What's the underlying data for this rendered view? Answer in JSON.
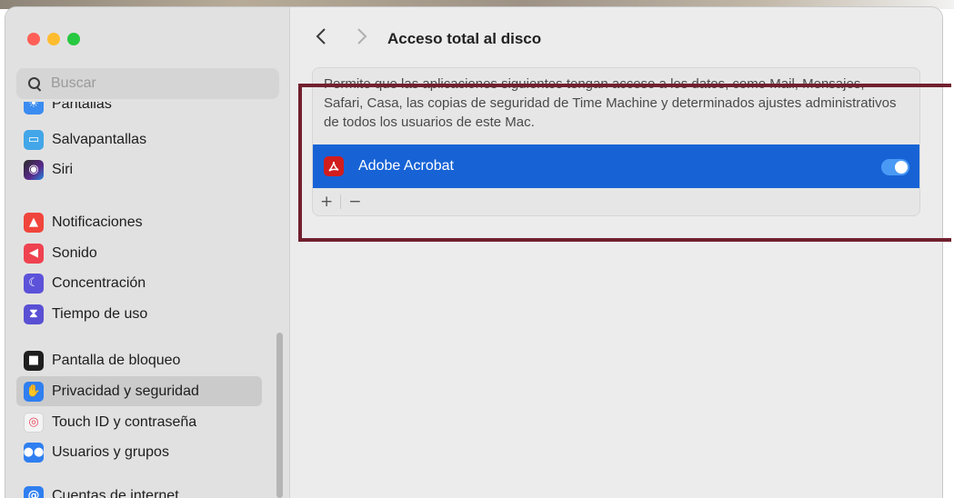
{
  "colors": {
    "accent": "#1763d6",
    "annotation_box": "#72202e"
  },
  "search": {
    "placeholder": "Buscar"
  },
  "sidebar": {
    "items": [
      {
        "label": "Pantallas",
        "icon": "display-icon",
        "color": "#3b8cf0"
      },
      {
        "label": "Salvapantallas",
        "icon": "screensaver-icon",
        "color": "#43a6e8"
      },
      {
        "label": "Siri",
        "icon": "siri-icon",
        "color": "#333333"
      },
      {
        "label": "Notificaciones",
        "icon": "bell-icon",
        "color": "#f0453c"
      },
      {
        "label": "Sonido",
        "icon": "speaker-icon",
        "color": "#ef4250"
      },
      {
        "label": "Concentración",
        "icon": "moon-icon",
        "color": "#5c52d9"
      },
      {
        "label": "Tiempo de uso",
        "icon": "hourglass-icon",
        "color": "#5950d4"
      },
      {
        "label": "Pantalla de bloqueo",
        "icon": "lock-icon",
        "color": "#1f1f1f"
      },
      {
        "label": "Privacidad y seguridad",
        "icon": "hand-icon",
        "color": "#2f7ff0",
        "selected": true
      },
      {
        "label": "Touch ID y contraseña",
        "icon": "fingerprint-icon",
        "color": "#f4f4f4"
      },
      {
        "label": "Usuarios y grupos",
        "icon": "users-icon",
        "color": "#2f7ff0"
      },
      {
        "label": "Cuentas de internet",
        "icon": "at-icon",
        "color": "#2f7ff0"
      }
    ]
  },
  "toolbar": {
    "back_icon": "chevron-left-icon",
    "forward_icon": "chevron-right-icon",
    "title": "Acceso total al disco"
  },
  "panel": {
    "description": "Permite que las aplicaciones siguientes tengan acceso a los datos, como Mail, Mensajes, Safari, Casa, las copias de seguridad de Time Machine y determinados ajustes administrativos de todos los usuarios de este Mac.",
    "apps": [
      {
        "name": "Adobe Acrobat",
        "icon": "acrobat-icon",
        "enabled": true
      }
    ],
    "add_label": "+",
    "remove_label": "−"
  }
}
